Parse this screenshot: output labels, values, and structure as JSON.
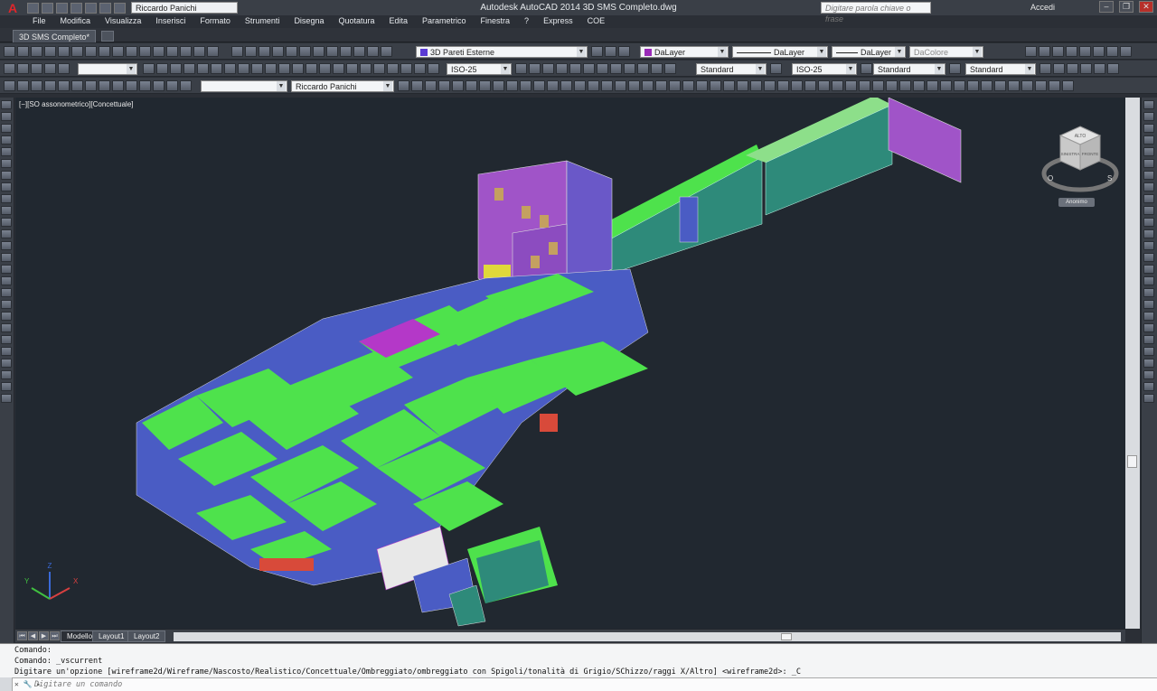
{
  "app": {
    "title": "Autodesk AutoCAD 2014   3D SMS Completo.dwg",
    "logo_letter": "A",
    "workspace_user": "Riccardo Panichi",
    "search_placeholder": "Digitare parola chiave o frase",
    "signin": "Accedi"
  },
  "menu": [
    "File",
    "Modifica",
    "Visualizza",
    "Inserisci",
    "Formato",
    "Strumenti",
    "Disegna",
    "Quotatura",
    "Edita",
    "Parametrico",
    "Finestra",
    "?",
    "Express",
    "COE"
  ],
  "tabs": {
    "document": "3D SMS Completo*"
  },
  "toolbars": {
    "layer": "3D Pareti Esterne",
    "layer_color": "#5a3bd4",
    "color": "DaLayer",
    "color_swatch": "#9a2bb8",
    "linetype": "DaLayer",
    "lineweight": "DaLayer",
    "plotstyle": "DaColore",
    "dimstyle1": "ISO-25",
    "textstyle": "Standard",
    "dimstyle2": "ISO-25",
    "tablestyle": "Standard",
    "mleaderstyle": "Standard",
    "ucs_name": "Riccardo Panichi"
  },
  "viewport": {
    "label": "[−][SO assonometrico][Concettuale]",
    "viewcube": {
      "top": "ALTO",
      "left": "SINISTRA",
      "front": "FRONTE",
      "compass_w": "O",
      "compass_e": "S"
    },
    "anon_label": "Anonimo",
    "ucs": {
      "x": "X",
      "y": "Y",
      "z": "Z"
    }
  },
  "layout_tabs": [
    "Modello",
    "Layout1",
    "Layout2"
  ],
  "command": {
    "history": [
      "Comando:",
      "Comando: _vscurrent",
      "Digitare un'opzione [wireframe2d/Wireframe/Nascosto/Realistico/Concettuale/Ombreggiato/ombreggiato con Spigoli/tonalità di Grigio/SChizzo/raggi X/Altro] <wireframe2d>: _C"
    ],
    "placeholder": "Digitare un comando"
  },
  "colors": {
    "green": "#4ee24c",
    "teal": "#2e8a7a",
    "blue": "#4a5cc4",
    "purple": "#9a5ad0",
    "magenta": "#b438c8",
    "tan": "#c4a060",
    "yellow": "#e0d83a",
    "red": "#d84a3a",
    "viewport_bg": "#212830"
  }
}
